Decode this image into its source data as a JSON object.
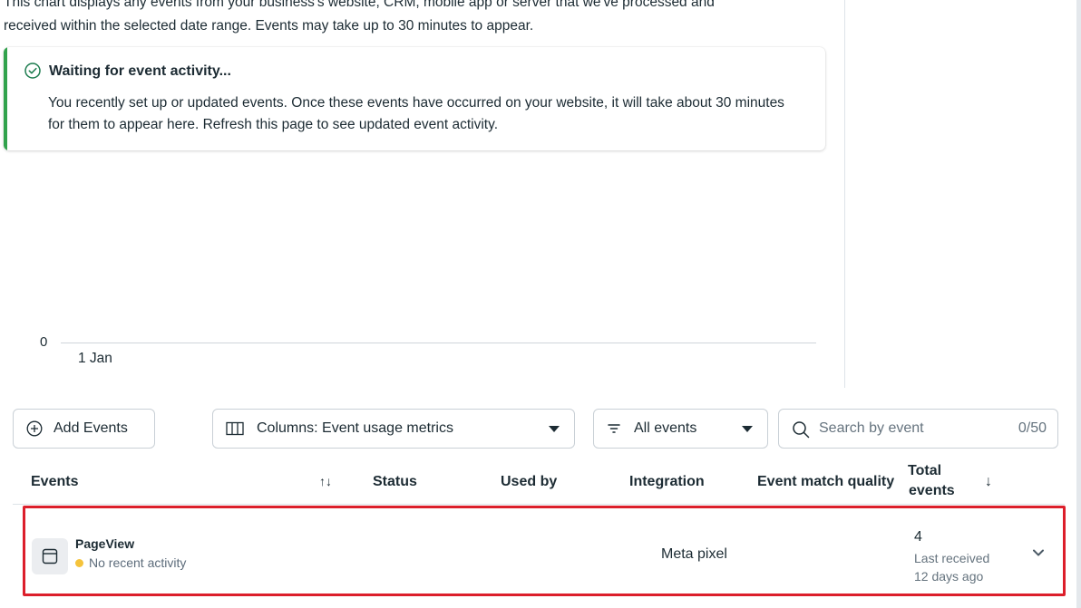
{
  "intro": {
    "line1": "This chart displays any events from your business's website, CRM, mobile app or server that we've processed and",
    "line2": "received within the selected date range. Events may take up to 30 minutes to appear."
  },
  "notice": {
    "icon": "check-circle-icon",
    "title": "Waiting for event activity...",
    "body": "You recently set up or updated events. Once these events have occurred on your website, it will take about 30 minutes for them to appear here. Refresh this page to see updated event activity.",
    "accent": "#31a24c"
  },
  "chart_data": {
    "type": "line",
    "x": [
      "1 Jan"
    ],
    "y_ticks": [
      "0"
    ],
    "series": []
  },
  "toolbar": {
    "add_label": "Add Events",
    "columns_label": "Columns: Event usage metrics",
    "filter_label": "All events",
    "search_placeholder": "Search by event",
    "search_count": "0/50"
  },
  "table": {
    "headers": {
      "events": "Events",
      "sort": "↑↓",
      "status": "Status",
      "used_by": "Used by",
      "integration": "Integration",
      "emq": "Event match quality",
      "total_line1": "Total",
      "total_line2": "events",
      "total_sort": "↓"
    },
    "rows": [
      {
        "icon": "browser-window-icon",
        "name": "PageView",
        "status": "No recent activity",
        "status_color": "#f5c33b",
        "integration": "Meta pixel",
        "total": "4",
        "last_received_label": "Last received",
        "last_received_value": "12 days ago"
      }
    ]
  },
  "highlight_color": "#dc1f2b"
}
